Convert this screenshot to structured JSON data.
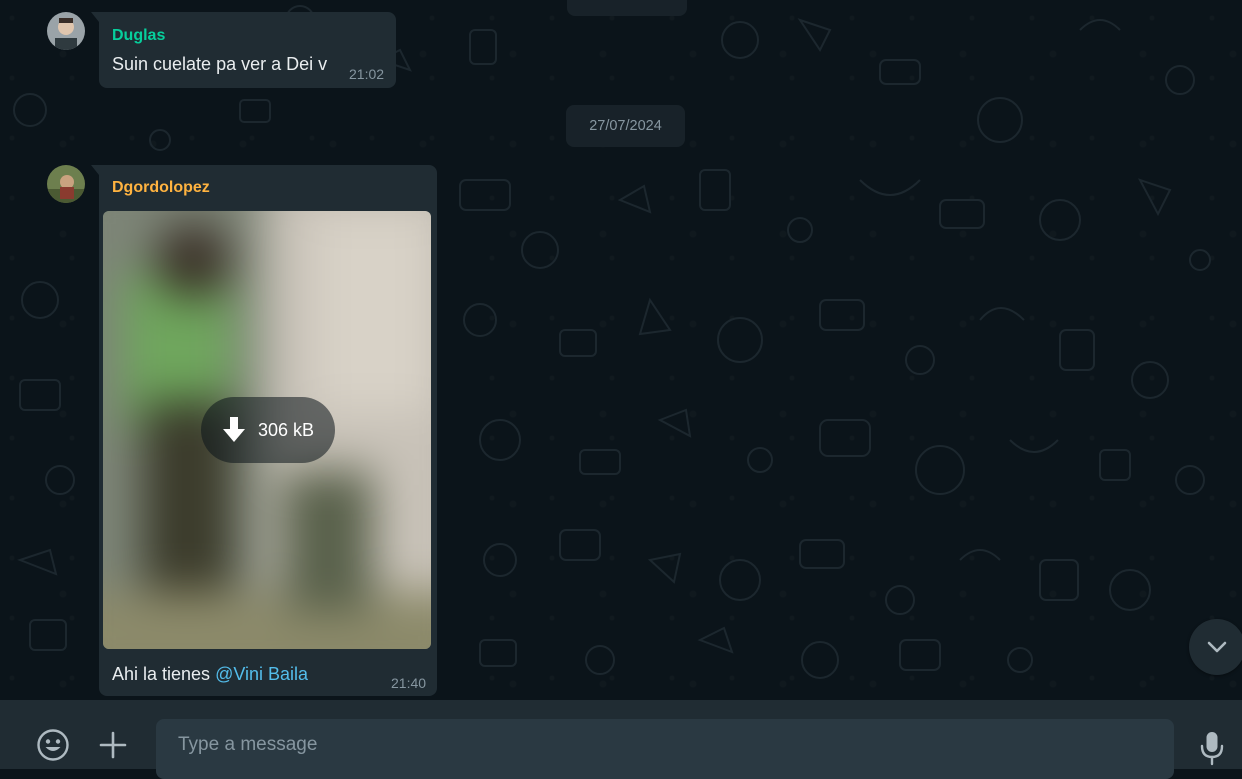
{
  "date_separator": "27/07/2024",
  "messages": [
    {
      "sender": "Duglas",
      "sender_color": "#06cf9c",
      "text": "Suin cuelate pa ver a Dei v",
      "time": "21:02"
    },
    {
      "sender": "Dgordolopez",
      "sender_color": "#ffb340",
      "media": {
        "type": "image",
        "download_size": "306 kB",
        "icon": "download-arrow-icon"
      },
      "text": "Ahi la tienes ",
      "mention": "@Vini Baila",
      "time": "21:40"
    }
  ],
  "scroll_button": {
    "icon": "chevron-down-icon"
  },
  "composer": {
    "emoji_icon": "smiley-icon",
    "attach_icon": "plus-icon",
    "placeholder": "Type a message",
    "mic_icon": "microphone-icon"
  },
  "colors": {
    "chat_background": "#0b141a",
    "bubble": "#202c33",
    "composer": "#202c33",
    "input": "#2a3942",
    "mention": "#53bdeb"
  }
}
